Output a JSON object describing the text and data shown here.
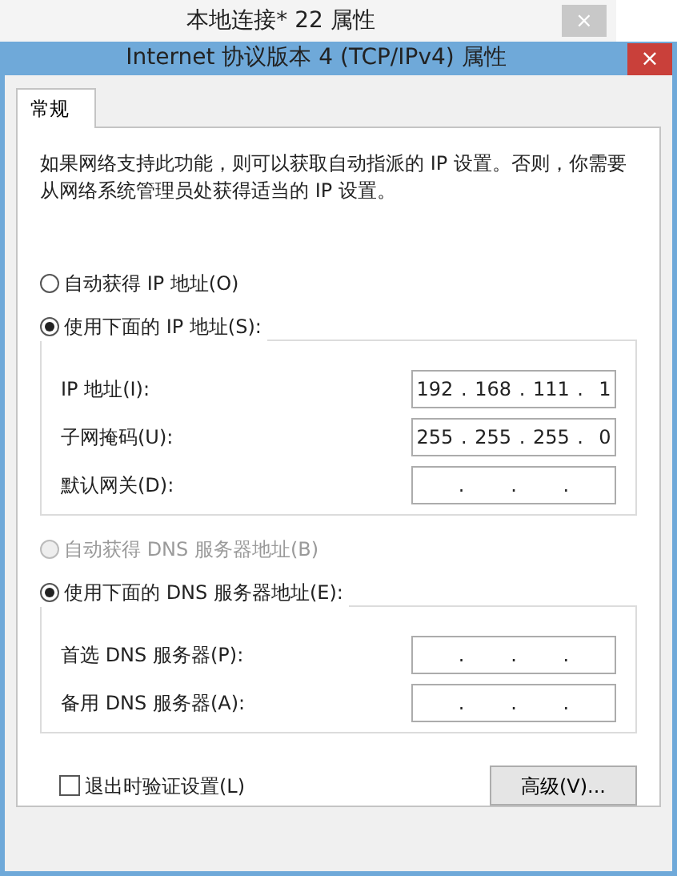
{
  "back_window": {
    "title": "本地连接* 22 属性",
    "close": "×"
  },
  "window": {
    "title": "Internet 协议版本 4 (TCP/IPv4) 属性",
    "close": "×"
  },
  "tabs": [
    {
      "label": "常规",
      "selected": true
    }
  ],
  "description": "如果网络支持此功能，则可以获取自动指派的 IP 设置。否则，你需要从网络系统管理员处获得适当的 IP 设置。",
  "sections": [
    {
      "auto_option": {
        "label": "自动获得 IP 地址(O)",
        "selected": false,
        "disabled": false
      },
      "manual_option": {
        "label": "使用下面的 IP 地址(S):",
        "selected": true,
        "disabled": false
      },
      "fields": [
        {
          "label": "IP 地址(I):",
          "value": "192 . 168 . 111 .  1"
        },
        {
          "label": "子网掩码(U):",
          "value": "255 . 255 . 255 .  0"
        },
        {
          "label": "默认网关(D):",
          "value": ".      .      ."
        }
      ]
    },
    {
      "auto_option": {
        "label": "自动获得 DNS 服务器地址(B)",
        "selected": false,
        "disabled": true
      },
      "manual_option": {
        "label": "使用下面的 DNS 服务器地址(E):",
        "selected": true,
        "disabled": false
      },
      "fields": [
        {
          "label": "首选 DNS 服务器(P):",
          "value": ".      .      ."
        },
        {
          "label": "备用 DNS 服务器(A):",
          "value": ".      .      ."
        }
      ]
    }
  ],
  "validate_checkbox": {
    "label": "退出时验证设置(L)",
    "checked": false
  },
  "advanced_button": "高级(V)..."
}
